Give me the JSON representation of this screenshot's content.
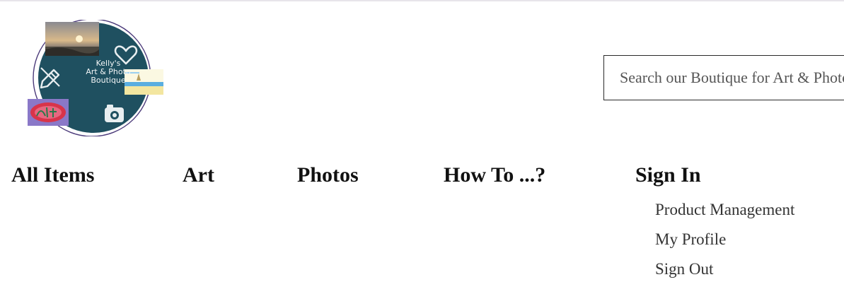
{
  "logo": {
    "text": "Kelly's\nArt & Photo\nBoutique",
    "colors": {
      "circle": "#1f5060",
      "ring": "#4b3a7a"
    },
    "icons": [
      "pencil-icon",
      "heart-icon",
      "camera-icon"
    ]
  },
  "search": {
    "placeholder": "Search our Boutique for Art & Photos",
    "value": ""
  },
  "nav": {
    "items": [
      {
        "label": "All Items"
      },
      {
        "label": "Art"
      },
      {
        "label": "Photos"
      },
      {
        "label": "How To ...?"
      },
      {
        "label": "Sign In"
      }
    ],
    "submenu": [
      {
        "label": "Product Management"
      },
      {
        "label": "My Profile"
      },
      {
        "label": "Sign Out"
      }
    ]
  }
}
